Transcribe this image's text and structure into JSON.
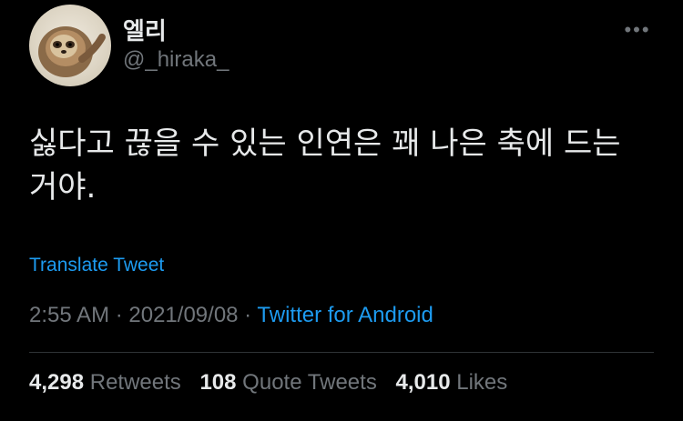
{
  "author": {
    "display_name": "엘리",
    "handle": "@_hiraka_",
    "avatar": "sloth-avatar"
  },
  "more_icon": "more-horizontal-icon",
  "more_label": "•••",
  "tweet": {
    "text": "싫다고 끊을 수 있는 인연은 꽤 나은 축에 드는\n거야.",
    "translate_label": "Translate Tweet",
    "time": "2:55 AM",
    "separator": " · ",
    "date": "2021/09/08",
    "source": "Twitter for Android"
  },
  "stats": {
    "retweets_count": "4,298",
    "retweets_label": "Retweets",
    "quotes_count": "108",
    "quotes_label": "Quote Tweets",
    "likes_count": "4,010",
    "likes_label": "Likes"
  },
  "colors": {
    "background": "#000000",
    "text": "#e7e9ea",
    "secondary": "#71767b",
    "accent": "#1d9bf0",
    "divider": "#2f3336"
  }
}
